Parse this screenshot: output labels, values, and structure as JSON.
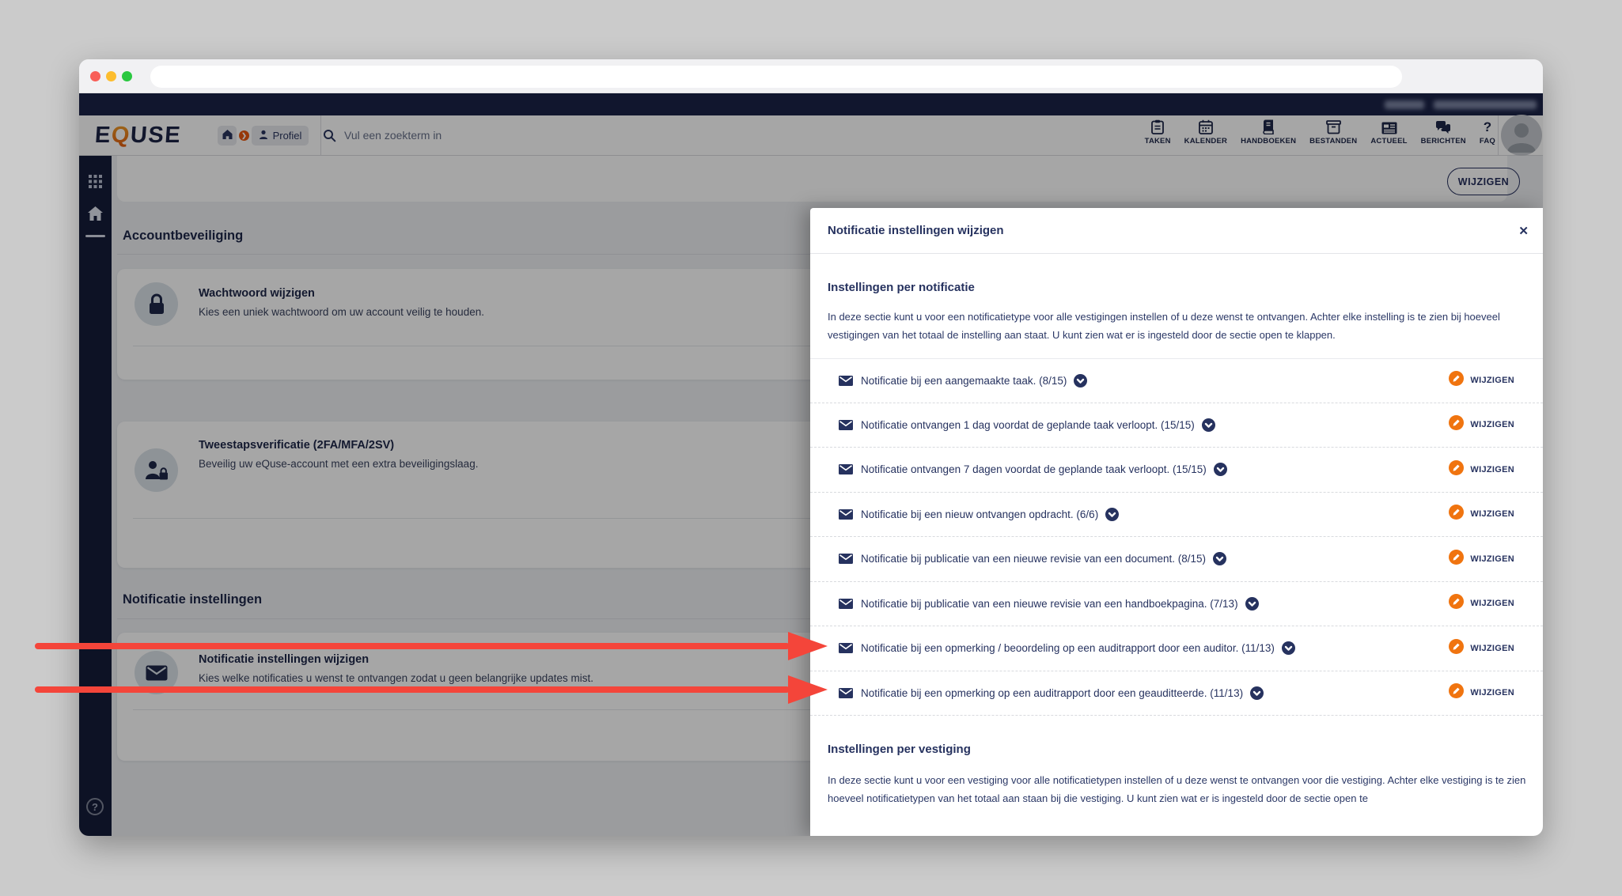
{
  "colors": {
    "navy": "#26325f",
    "dark_navy": "#1b2347",
    "orange": "#f0740f",
    "badge_orange": "#e8570e",
    "arrow_red": "#f4453a"
  },
  "browser": {
    "url": ""
  },
  "topstrip": {},
  "header": {
    "logo": {
      "prefix": "E",
      "q": "Q",
      "suffix": "USE"
    },
    "breadcrumb": {
      "chevron_char": "❯",
      "profiel_label": "Profiel"
    },
    "search_placeholder": "Vul een zoekterm in",
    "nav": [
      {
        "label": "TAKEN"
      },
      {
        "label": "KALENDER"
      },
      {
        "label": "HANDBOEKEN"
      },
      {
        "label": "BESTANDEN"
      },
      {
        "label": "ACTUEEL"
      },
      {
        "label": "BERICHTEN"
      },
      {
        "label": "FAQ",
        "icon_char": "?"
      }
    ]
  },
  "sidebar": {
    "help_icon_char": "?"
  },
  "content": {
    "wijzigen_button": "WIJZIGEN",
    "account_heading": "Accountbeveiliging",
    "cards": [
      {
        "title": "Wachtwoord wijzigen",
        "desc": "Kies een uniek wachtwoord om uw account veilig te houden."
      },
      {
        "title": "Tweestapsverificatie (2FA/MFA/2SV)",
        "desc": "Beveilig uw eQuse-account met een extra beveiligingslaag."
      },
      {
        "title": "Notificatie instellingen wijzigen",
        "desc": "Kies welke notificaties u wenst te ontvangen zodat u geen belangrijke updates mist."
      }
    ],
    "notif_heading": "Notificatie instellingen"
  },
  "modal": {
    "title": "Notificatie instellingen wijzigen",
    "close_char": "✕",
    "section1": {
      "heading": "Instellingen per notificatie",
      "description": "In deze sectie kunt u voor een notificatietype voor alle vestigingen instellen of u deze wenst te ontvangen. Achter elke instelling is te zien bij hoeveel vestigingen van het totaal de instelling aan staat. U kunt zien wat er is ingesteld door de sectie open te klappen."
    },
    "rows": [
      {
        "label": "Notificatie bij een aangemaakte taak. (8/15)",
        "action": "WIJZIGEN"
      },
      {
        "label": "Notificatie ontvangen 1 dag voordat de geplande taak verloopt. (15/15)",
        "action": "WIJZIGEN"
      },
      {
        "label": "Notificatie ontvangen 7 dagen voordat de geplande taak verloopt. (15/15)",
        "action": "WIJZIGEN"
      },
      {
        "label": "Notificatie bij een nieuw ontvangen opdracht. (6/6)",
        "action": "WIJZIGEN"
      },
      {
        "label": "Notificatie bij publicatie van een nieuwe revisie van een document. (8/15)",
        "action": "WIJZIGEN"
      },
      {
        "label": "Notificatie bij publicatie van een nieuwe revisie van een handboekpagina. (7/13)",
        "action": "WIJZIGEN"
      },
      {
        "label": "Notificatie bij een opmerking / beoordeling op een auditrapport door een auditor. (11/13)",
        "action": "WIJZIGEN"
      },
      {
        "label": "Notificatie bij een opmerking op een auditrapport door een geauditteerde. (11/13)",
        "action": "WIJZIGEN"
      }
    ],
    "section2": {
      "heading": "Instellingen per vestiging",
      "description": "In deze sectie kunt u voor een vestiging voor alle notificatietypen instellen of u deze wenst te ontvangen voor die vestiging. Achter elke vestiging is te zien hoeveel notificatietypen van het totaal aan staan bij die vestiging. U kunt zien wat er is ingesteld door de sectie open te"
    }
  }
}
